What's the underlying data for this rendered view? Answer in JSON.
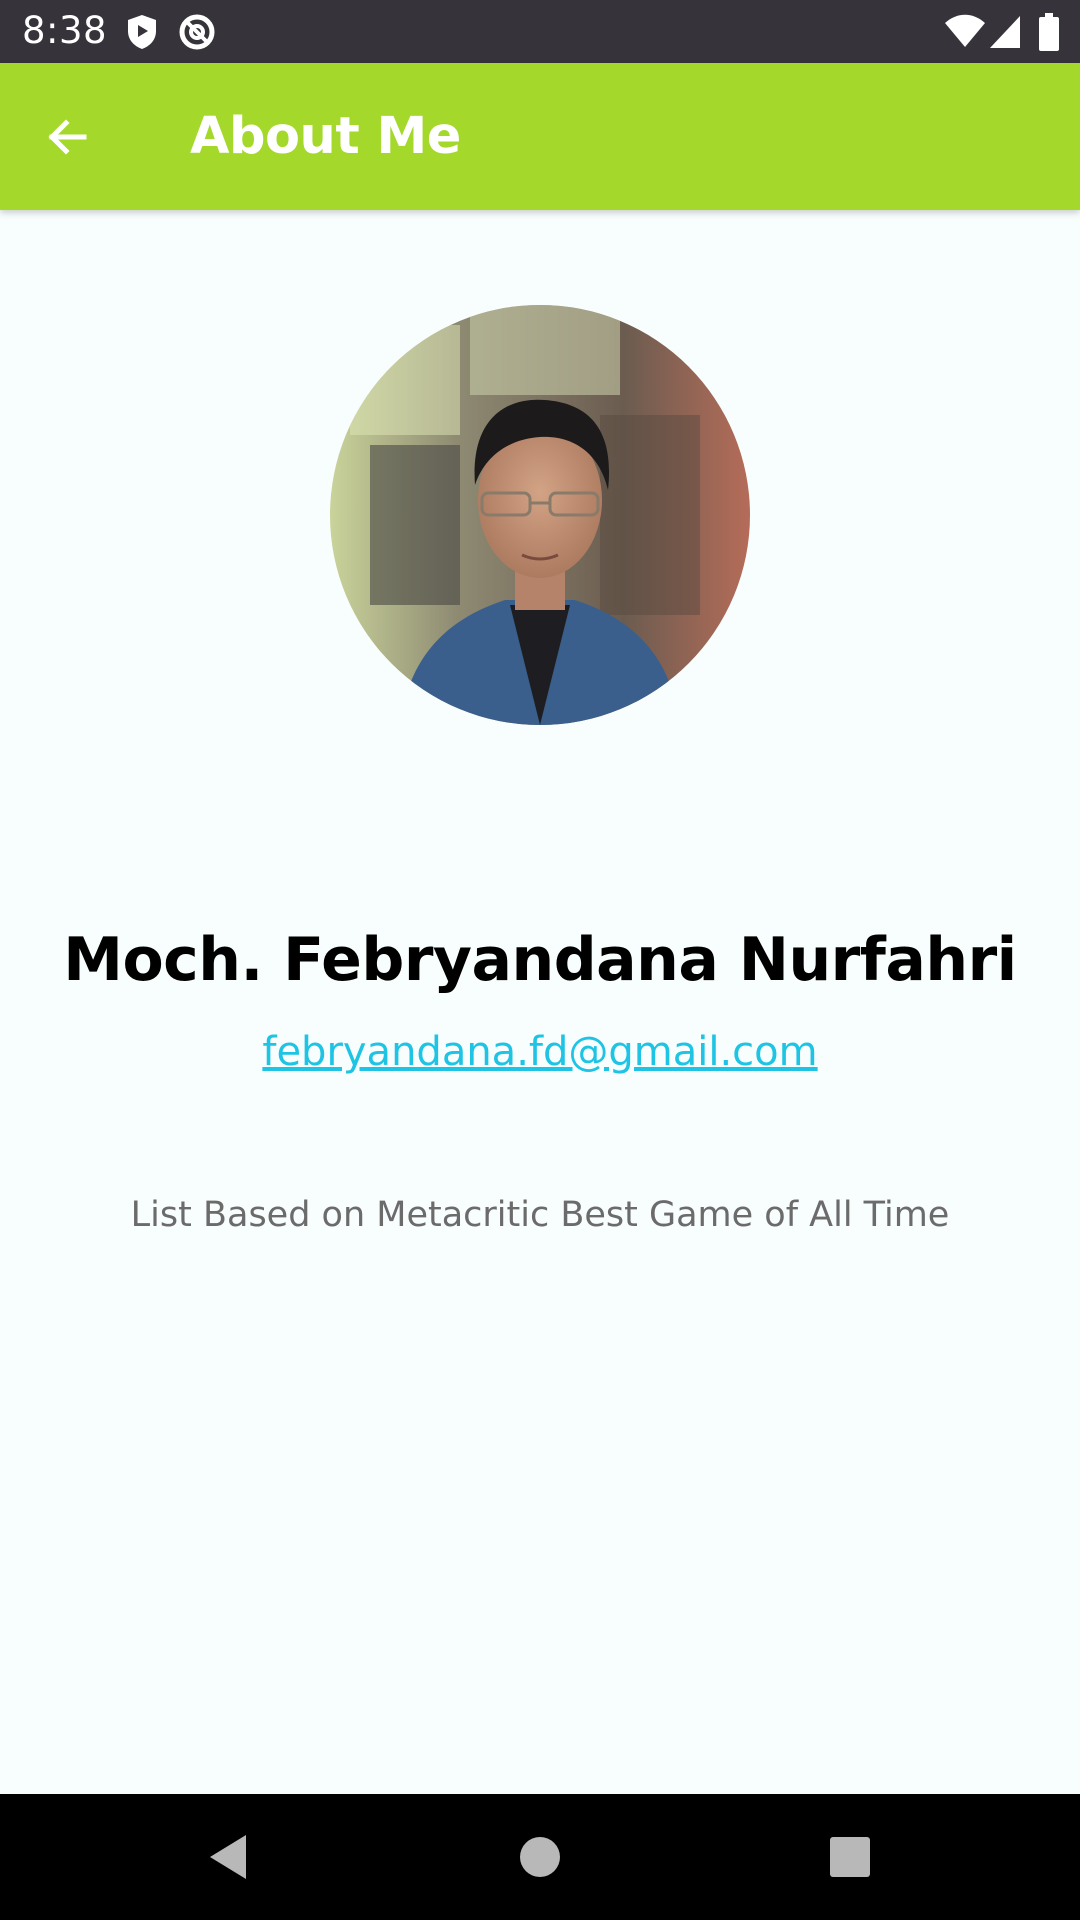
{
  "status_bar": {
    "time": "8:38",
    "icons": [
      "play-protect-icon",
      "data-saver-icon",
      "wifi-icon",
      "signal-icon",
      "battery-icon"
    ]
  },
  "app_bar": {
    "title": "About Me",
    "back_icon": "arrow-back-icon",
    "background_color": "#a4d82b"
  },
  "profile": {
    "avatar": "profile-photo",
    "name": "Moch. Febryandana Nurfahri",
    "email": "febryandana.fd@gmail.com",
    "caption": "List Based on Metacritic Best Game of All Time"
  },
  "colors": {
    "accent": "#a4d82b",
    "link": "#1fc4e4",
    "background": "#f8fdfd"
  },
  "nav_bar": {
    "buttons": [
      "back-triangle-icon",
      "home-circle-icon",
      "recents-square-icon"
    ]
  }
}
